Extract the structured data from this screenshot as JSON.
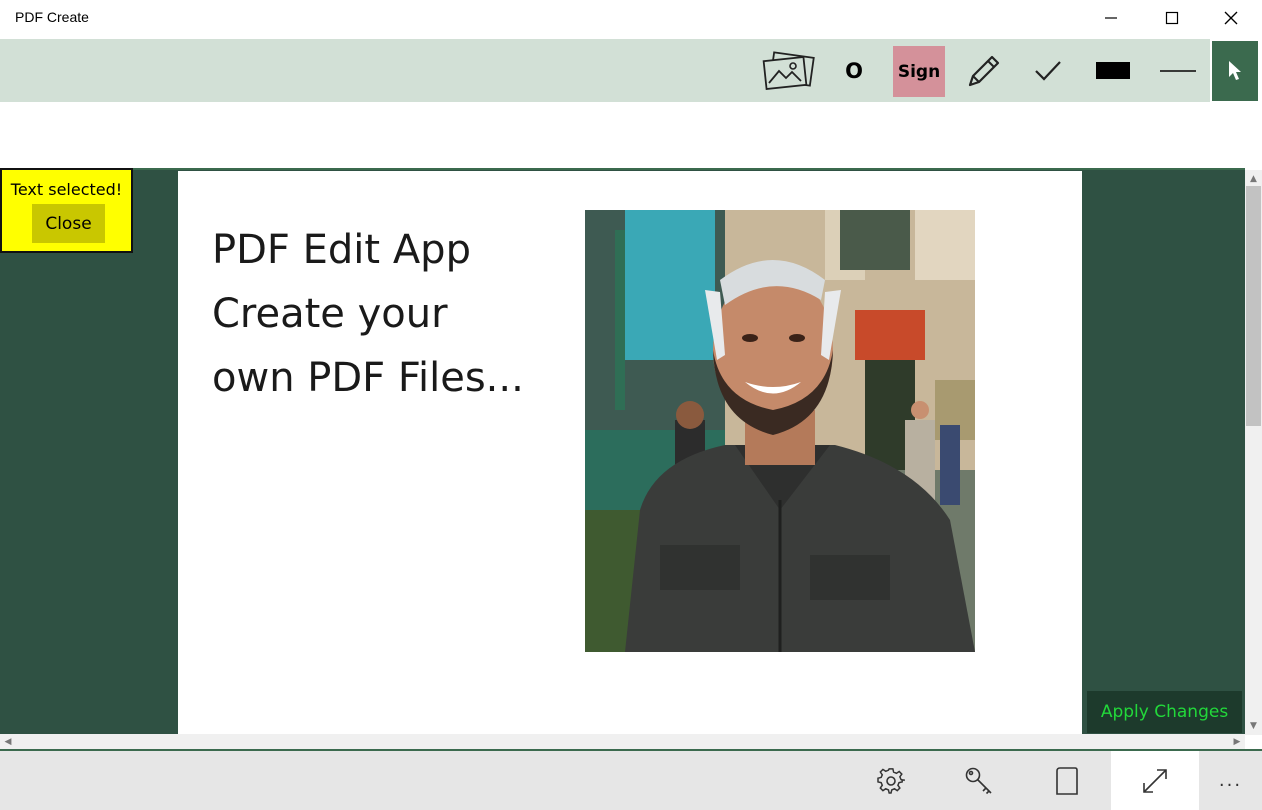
{
  "window": {
    "title": "PDF Create",
    "controls": {
      "minimize": "minimize-icon",
      "maximize": "maximize-icon",
      "close": "close-icon"
    }
  },
  "toolbar": {
    "tools": [
      {
        "name": "insert-image",
        "icon": "image-icon"
      },
      {
        "name": "ellipse",
        "label": "O"
      },
      {
        "name": "sign",
        "label": "Sign",
        "active_color": "#d4919a"
      },
      {
        "name": "pencil",
        "icon": "pencil-icon"
      },
      {
        "name": "checkmark",
        "icon": "check-icon"
      },
      {
        "name": "rectangle",
        "icon": "filled-rectangle-icon"
      },
      {
        "name": "line",
        "icon": "line-icon"
      },
      {
        "name": "select",
        "icon": "cursor-icon",
        "active_color": "#3b6a4e"
      }
    ]
  },
  "document": {
    "text_lines": [
      "PDF Edit App",
      "Create your",
      "own PDF Files..."
    ],
    "background_color": "#2f5143"
  },
  "notification": {
    "message": "Text selected!",
    "close_label": "Close",
    "color": "#ffff00"
  },
  "actions": {
    "apply_label": "Apply Changes"
  },
  "bottom_bar": {
    "buttons": [
      {
        "name": "settings",
        "icon": "gear-icon"
      },
      {
        "name": "key",
        "icon": "key-icon"
      },
      {
        "name": "page",
        "icon": "page-icon"
      },
      {
        "name": "expand",
        "icon": "expand-icon"
      }
    ],
    "more_label": "..."
  }
}
